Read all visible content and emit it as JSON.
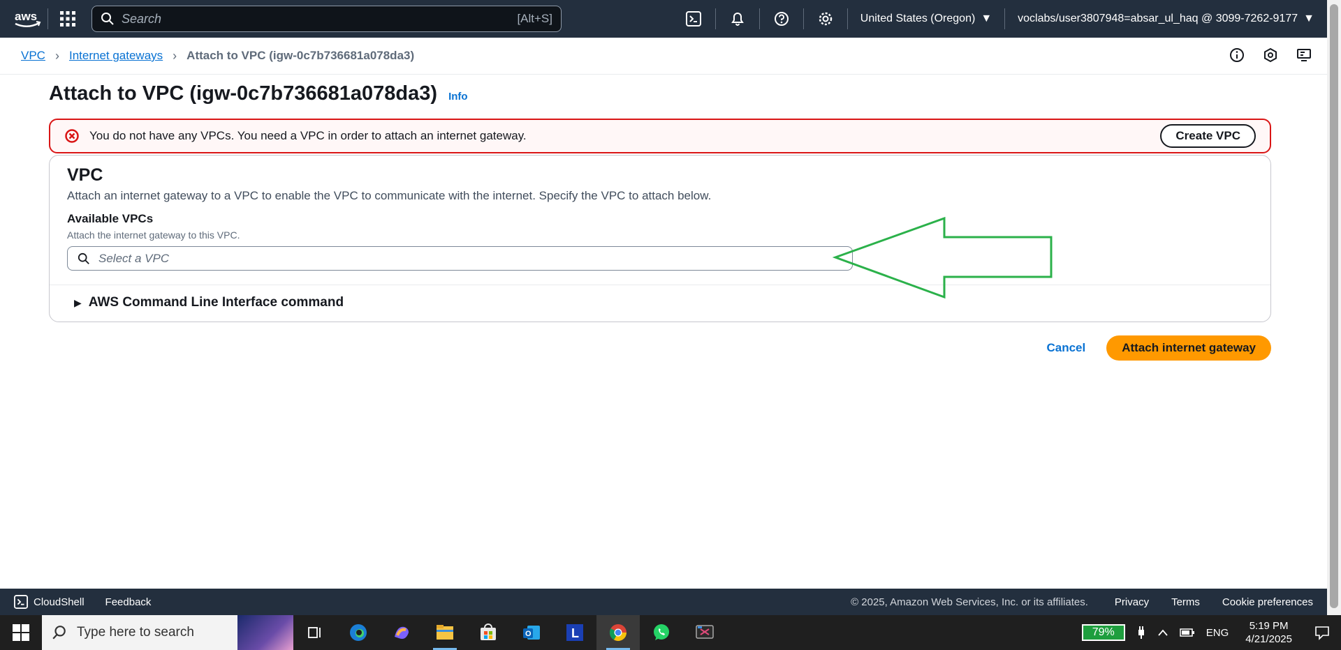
{
  "topnav": {
    "logo_text": "aws",
    "search_placeholder": "Search",
    "search_shortcut": "[Alt+S]",
    "region": "United States (Oregon)",
    "account": "voclabs/user3807948=absar_ul_haq @ 3099-7262-9177",
    "colors": {
      "background": "#232f3e"
    }
  },
  "breadcrumb": {
    "items": [
      "VPC",
      "Internet gateways"
    ],
    "current": "Attach to VPC (igw-0c7b736681a078da3)"
  },
  "page": {
    "title": "Attach to VPC (igw-0c7b736681a078da3)",
    "info_label": "Info"
  },
  "alert": {
    "message": "You do not have any VPCs. You need a VPC in order to attach an internet gateway.",
    "button_label": "Create VPC",
    "color": "#d91515"
  },
  "vpc_panel": {
    "heading": "VPC",
    "description": "Attach an internet gateway to a VPC to enable the VPC to communicate with the internet. Specify the VPC to attach below.",
    "field_label": "Available VPCs",
    "field_description": "Attach the internet gateway to this VPC.",
    "select_placeholder": "Select a VPC",
    "cli_label": "AWS Command Line Interface command"
  },
  "actions": {
    "cancel_label": "Cancel",
    "attach_label": "Attach internet gateway",
    "primary_color": "#ff9900"
  },
  "footer": {
    "cloudshell": "CloudShell",
    "feedback": "Feedback",
    "copyright": "© 2025, Amazon Web Services, Inc. or its affiliates.",
    "links": [
      "Privacy",
      "Terms",
      "Cookie preferences"
    ]
  },
  "taskbar": {
    "search_placeholder": "Type here to search",
    "battery": "79%",
    "language": "ENG",
    "time": "5:19 PM",
    "date": "4/21/2025",
    "apps": [
      "task-view",
      "edge",
      "copilot",
      "file-explorer",
      "store",
      "outlook",
      "l-app",
      "chrome",
      "whatsapp",
      "snipping-tool"
    ]
  },
  "annotation": {
    "arrow_color": "#2bb14a"
  }
}
